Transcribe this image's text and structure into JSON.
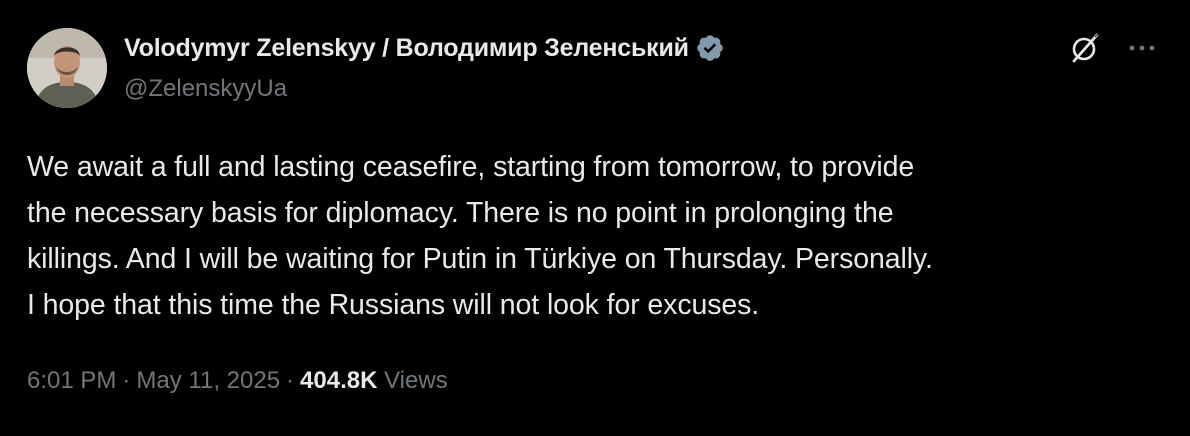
{
  "author": {
    "display_name": "Volodymyr Zelenskyy / Володимир Зеленський",
    "handle": "@ZelenskyyUa",
    "verified_color": "#829aab"
  },
  "tweet": {
    "lines": [
      "We await a full and lasting ceasefire, starting from tomorrow, to provide",
      "the necessary basis for diplomacy. There is no point in prolonging the",
      "killings. And I will be waiting for Putin in Türkiye on Thursday. Personally.",
      "I hope that this time the Russians will not look for excuses."
    ]
  },
  "meta": {
    "time": "6:01 PM",
    "separator": "·",
    "date": "May 11, 2025",
    "views_count": "404.8K",
    "views_label": "Views"
  },
  "icons": {
    "grok": "grok-icon",
    "more": "more-horizontal-icon",
    "verified": "verified-badge-icon"
  },
  "colors": {
    "background": "#000000",
    "text_primary": "#e7e9ea",
    "text_secondary": "#71767b"
  }
}
